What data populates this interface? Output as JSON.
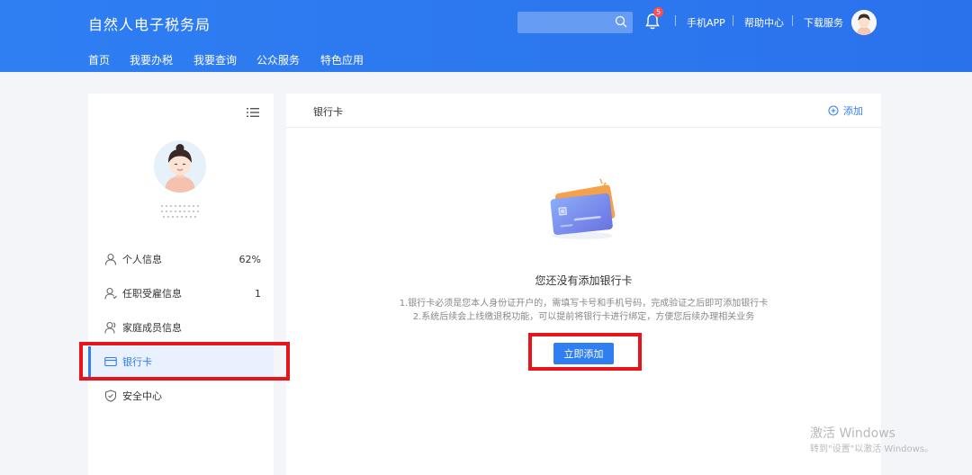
{
  "header": {
    "title": "自然人电子税务局",
    "search_placeholder": "",
    "notification_count": "5",
    "links": [
      "手机APP",
      "帮助中心",
      "下载服务"
    ]
  },
  "nav": {
    "items": [
      "首页",
      "我要办税",
      "我要查询",
      "公众服务",
      "特色应用"
    ]
  },
  "sidebar": {
    "items": [
      {
        "label": "个人信息",
        "value": "62%"
      },
      {
        "label": "任职受雇信息",
        "value": "1"
      },
      {
        "label": "家庭成员信息",
        "value": ""
      },
      {
        "label": "银行卡",
        "value": ""
      },
      {
        "label": "安全中心",
        "value": ""
      }
    ]
  },
  "main": {
    "title": "银行卡",
    "add_label": "添加",
    "empty_title": "您还没有添加银行卡",
    "desc_line1": "1.银行卡必须是您本人身份证开户的，需填写卡号和手机号码，完成验证之后即可添加银行卡",
    "desc_line2": "2.系统后续会上线缴退税功能，可以提前将银行卡进行绑定，方便您后续办理相关业务",
    "add_button": "立即添加"
  },
  "watermark": {
    "line1": "激活 Windows",
    "line2": "转到\"设置\"以激活 Windows。"
  },
  "colors": {
    "primary": "#2f7ef2",
    "annotation": "#e8141b"
  }
}
